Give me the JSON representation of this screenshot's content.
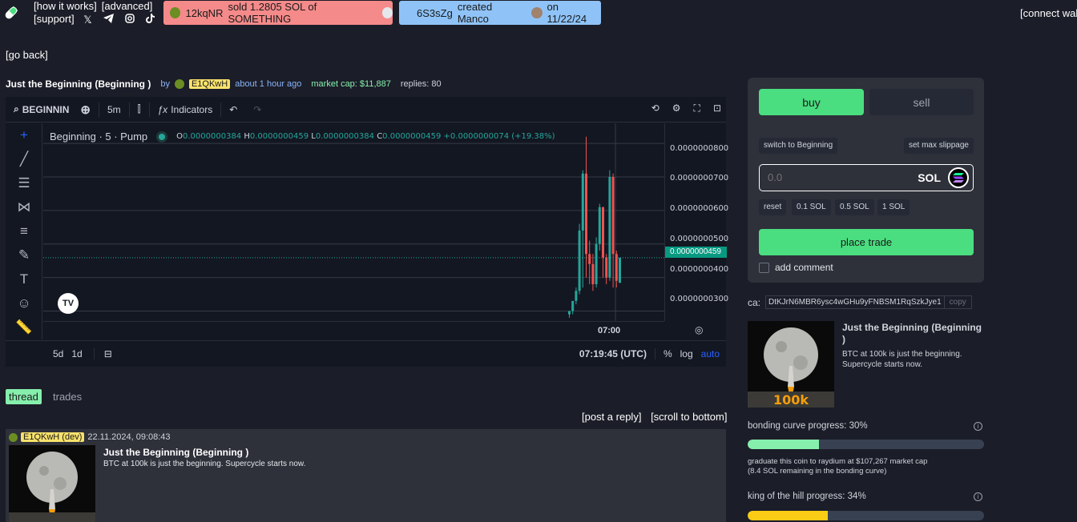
{
  "header": {
    "links": [
      "[how it works]",
      "[advanced]",
      "[support]"
    ],
    "socials": [
      "x-icon",
      "telegram-icon",
      "instagram-icon",
      "tiktok-icon"
    ],
    "connect_wallet": "[connect wal"
  },
  "tickers": [
    {
      "user": "12kqNR",
      "text": "sold 1.2805 SOL of SOMETHING",
      "color": "#f58a8a"
    },
    {
      "user": "6S3sZg",
      "text": "created Manco",
      "date": "on 11/22/24",
      "color": "#8fc3f7"
    }
  ],
  "go_back": "[go back]",
  "coin": {
    "title": "Just the Beginning (Beginning )",
    "by": "by",
    "creator": "E1QKwH",
    "age": "about 1 hour ago",
    "market_cap": "market cap: $11,887",
    "replies": "replies: 80"
  },
  "chart": {
    "symbol": "BEGINNIN",
    "interval": "5m",
    "indicators": "Indicators",
    "legend_name": "Beginning · 5 · Pump",
    "ohlc": {
      "o_label": "O",
      "o": "0.0000000384",
      "h_label": "H",
      "h": "0.0000000459",
      "l_label": "L",
      "l": "0.0000000384",
      "c_label": "C",
      "c": "0.0000000459",
      "change": "+0.0000000074 (+19.38%)"
    },
    "y_ticks": [
      "0.0000000800",
      "0.0000000700",
      "0.0000000600",
      "0.0000000500",
      "0.0000000400",
      "0.0000000300"
    ],
    "current_price": "0.0000000459",
    "x_tick": "07:00",
    "ranges": [
      "5d",
      "1d"
    ],
    "clock": "07:19:45 (UTC)",
    "pct": "%",
    "log": "log",
    "auto": "auto"
  },
  "chart_data": {
    "type": "candlestick",
    "title": "Beginning · 5 · Pump",
    "ylim": [
      2.7e-08,
      8.6e-08
    ],
    "y_ticks": [
      8e-08,
      7e-08,
      6e-08,
      5e-08,
      4e-08,
      3e-08
    ],
    "candles": [
      {
        "o": 2.9e-08,
        "h": 3e-08,
        "l": 2.8e-08,
        "c": 3e-08
      },
      {
        "o": 3e-08,
        "h": 3.3e-08,
        "l": 2.9e-08,
        "c": 3.3e-08
      },
      {
        "o": 3.3e-08,
        "h": 3.7e-08,
        "l": 3.2e-08,
        "c": 3.6e-08
      },
      {
        "o": 3.6e-08,
        "h": 5.6e-08,
        "l": 3.5e-08,
        "c": 5.4e-08
      },
      {
        "o": 5.4e-08,
        "h": 7.2e-08,
        "l": 3.7e-08,
        "c": 7.1e-08
      },
      {
        "o": 7.1e-08,
        "h": 8.2e-08,
        "l": 4e-08,
        "c": 4.7e-08
      },
      {
        "o": 4.7e-08,
        "h": 5.1e-08,
        "l": 3.8e-08,
        "c": 4.4e-08
      },
      {
        "o": 4.4e-08,
        "h": 4.7e-08,
        "l": 3.6e-08,
        "c": 3.8e-08
      },
      {
        "o": 3.8e-08,
        "h": 5.2e-08,
        "l": 3.7e-08,
        "c": 5e-08
      },
      {
        "o": 5e-08,
        "h": 6.2e-08,
        "l": 4.8e-08,
        "c": 6.1e-08
      },
      {
        "o": 6.1e-08,
        "h": 6.1e-08,
        "l": 4e-08,
        "c": 4.6e-08
      },
      {
        "o": 4.6e-08,
        "h": 4.7e-08,
        "l": 3.8e-08,
        "c": 4e-08
      },
      {
        "o": 4e-08,
        "h": 7.2e-08,
        "l": 3.9e-08,
        "c": 7e-08
      },
      {
        "o": 7e-08,
        "h": 7.1e-08,
        "l": 3.7e-08,
        "c": 4.7e-08
      },
      {
        "o": 4.7e-08,
        "h": 4.8e-08,
        "l": 3.7e-08,
        "c": 3.9e-08
      },
      {
        "o": 3.84e-08,
        "h": 4.59e-08,
        "l": 3.84e-08,
        "c": 4.59e-08
      }
    ],
    "colors": {
      "up": "#26a69a",
      "down": "#ef5350"
    }
  },
  "tabs": {
    "thread": "thread",
    "trades": "trades"
  },
  "post_links": {
    "post_reply": "[post a reply]",
    "scroll": "[scroll to bottom]"
  },
  "post": {
    "author": "E1QKwH (dev)",
    "timestamp": "22.11.2024, 09:08:43",
    "title": "Just the Beginning (Beginning )",
    "body": "BTC at 100k is just the beginning. Supercycle starts now."
  },
  "trade": {
    "buy": "buy",
    "sell": "sell",
    "switch": "switch to Beginning",
    "slippage": "set max slippage",
    "amount_placeholder": "0.0",
    "currency": "SOL",
    "presets": [
      "reset",
      "0.1 SOL",
      "0.5 SOL",
      "1 SOL"
    ],
    "place": "place trade",
    "add_comment": "add comment"
  },
  "ca": {
    "label": "ca:",
    "value": "DtKJrN6MBR6ysc4wGHu9yFNBSM1RqSzkJye1",
    "copy": "copy"
  },
  "info": {
    "title": "Just the Beginning (Beginning )",
    "desc": "BTC at 100k is just the beginning. Supercycle starts now.",
    "image_text": "100k"
  },
  "bonding": {
    "label": "bonding curve progress: 30%",
    "progress": 0.3,
    "color": "#86efac"
  },
  "graduate": {
    "line1": "graduate this coin to raydium at $107,267 market cap",
    "line2": "(8.4 SOL remaining in the bonding curve)"
  },
  "koth": {
    "label": "king of the hill progress: 34%",
    "progress": 0.34,
    "color": "#facc15"
  }
}
